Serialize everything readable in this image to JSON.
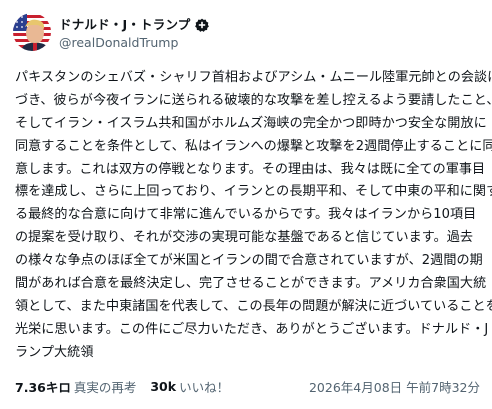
{
  "author": {
    "display_name": "ドナルド・J・トランプ",
    "handle": "@realDonaldTrump",
    "avatar_icon": "avatar-flag-portrait",
    "badge_icon": "affiliate-plus-badge"
  },
  "post": {
    "lines": [
      "パキスタンのシェバズ・シャリフ首相およびアシム・ムニール陸軍元帥との会談に基",
      "づき、彼らが今夜イランに送られる破壊的な攻撃を差し控えるよう要請したこと、",
      "そしてイラン・イスラム共和国がホルムズ海峡の完全かつ即時かつ安全な開放に",
      "同意することを条件として、私はイランへの爆撃と攻撃を2週間停止することに同",
      "意します。これは双方の停戦となります。その理由は、我々は既に全ての軍事目",
      "標を達成し、さらに上回っており、イランとの長期平和、そして中東の平和に関す",
      "る最終的な合意に向けて非常に進んでいるからです。我々はイランから10項目",
      "の提案を受け取り、それが交渉の実現可能な基盤であると信じています。過去",
      "の様々な争点のほぼ全てが米国とイランの間で合意されていますが、2週間の期",
      "間があれば合意を最終決定し、完了させることができます。アメリカ合衆国大統",
      "領として、また中東諸国を代表して、この長年の問題が解決に近づいていることを",
      "光栄に思います。この件にご尽力いただき、ありがとうございます。ドナルド・J・ト",
      "ランプ大統領"
    ]
  },
  "stats": {
    "reposts_count": "7.36キロ",
    "reposts_label": "真実の再考",
    "likes_count": "30k",
    "likes_label": "いいね！"
  },
  "timestamp": "2026年4月08日 午前7時32分",
  "colors": {
    "text_primary": "#0f1419",
    "text_secondary": "#536471",
    "badge_bg": "#0f1419",
    "flag_red": "#c8202f",
    "flag_blue": "#2a3f8f"
  }
}
